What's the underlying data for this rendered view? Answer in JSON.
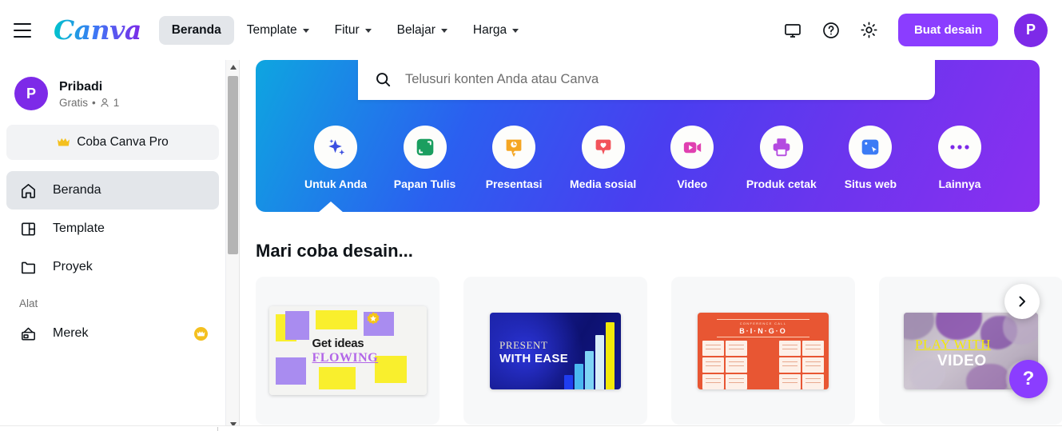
{
  "header": {
    "menu_icon": "hamburger-icon",
    "brand": "Canva",
    "nav": [
      {
        "label": "Beranda",
        "active": true,
        "caret": false
      },
      {
        "label": "Template",
        "active": false,
        "caret": true
      },
      {
        "label": "Fitur",
        "active": false,
        "caret": true
      },
      {
        "label": "Belajar",
        "active": false,
        "caret": true
      },
      {
        "label": "Harga",
        "active": false,
        "caret": true
      }
    ],
    "icons": [
      "monitor-icon",
      "help-circle-icon",
      "gear-icon"
    ],
    "create_button": "Buat desain",
    "avatar_initial": "P"
  },
  "sidebar": {
    "profile": {
      "avatar_initial": "P",
      "name": "Pribadi",
      "plan": "Gratis",
      "separator": "•",
      "members": "1"
    },
    "pro_banner": {
      "label": "Coba Canva Pro",
      "icon": "crown-icon"
    },
    "items": [
      {
        "label": "Beranda",
        "icon": "home-icon",
        "active": true,
        "pro": false
      },
      {
        "label": "Template",
        "icon": "template-icon",
        "active": false,
        "pro": false
      },
      {
        "label": "Proyek",
        "icon": "folder-icon",
        "active": false,
        "pro": false
      }
    ],
    "section_label": "Alat",
    "tools": [
      {
        "label": "Merek",
        "icon": "brand-icon",
        "active": false,
        "pro": true
      }
    ],
    "scrollbar": {
      "up_icon": "caret-up-icon",
      "down_icon": "caret-down-icon"
    }
  },
  "main": {
    "search": {
      "icon": "search-icon",
      "placeholder": "Telusuri konten Anda atau Canva",
      "value": ""
    },
    "categories": [
      {
        "label": "Untuk Anda",
        "icon": "sparkles-icon",
        "color": "#3b4fe0"
      },
      {
        "label": "Papan Tulis",
        "icon": "whiteboard-icon",
        "color": "#1a9e5f"
      },
      {
        "label": "Presentasi",
        "icon": "presentation-icon",
        "color": "#f5a623"
      },
      {
        "label": "Media sosial",
        "icon": "heart-chat-icon",
        "color": "#f2535b"
      },
      {
        "label": "Video",
        "icon": "video-camera-icon",
        "color": "#e040b0"
      },
      {
        "label": "Produk cetak",
        "icon": "printer-icon",
        "color": "#b44ae0"
      },
      {
        "label": "Situs web",
        "icon": "website-cursor-icon",
        "color": "#3b7bf5"
      },
      {
        "label": "Lainnya",
        "icon": "ellipsis-icon",
        "color": "#7d2ae8"
      }
    ],
    "section_title": "Mari coba desain...",
    "cards": [
      {
        "name": "whiteboard-card",
        "title_line1": "Get ideas",
        "title_line2": "FLOWING"
      },
      {
        "name": "presentation-card",
        "title_line1": "PRESENT",
        "title_line2": "WITH EASE"
      },
      {
        "name": "bingo-card",
        "header": "CONFERENCE CALL",
        "title": "B·I·N·G·O"
      },
      {
        "name": "video-card",
        "title_line1": "PLAY WITH",
        "title_line2": "VIDEO"
      }
    ],
    "next_button": "›",
    "help_button": "?"
  },
  "colors": {
    "brand_purple": "#8b3dff",
    "avatar_purple": "#7d2ae8",
    "banner_start": "#0ea5e0",
    "banner_end": "#8b2ff0",
    "active_bg": "#e3e6ea"
  }
}
